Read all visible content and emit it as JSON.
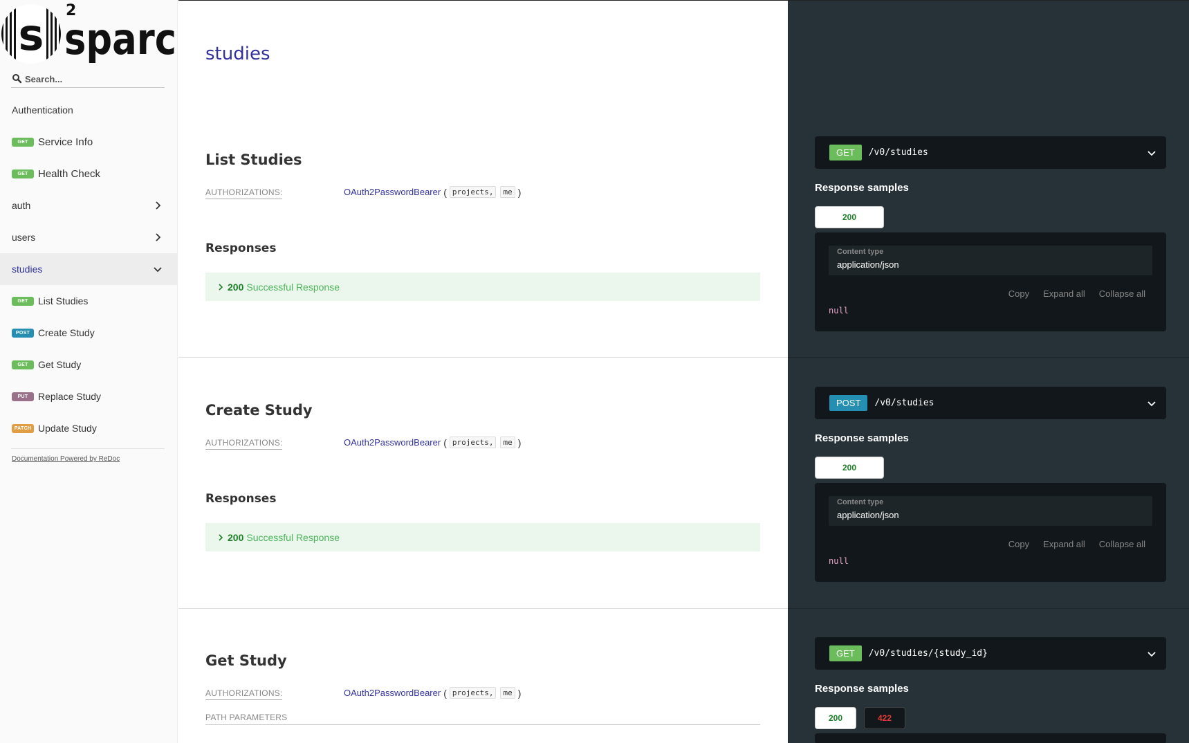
{
  "logo": {
    "text": "sparc",
    "superscript": "2"
  },
  "search": {
    "placeholder": "Search..."
  },
  "sidebar": {
    "items": [
      {
        "label": "Authentication",
        "badge": "",
        "expandable": false,
        "active": false
      },
      {
        "label": "Service Info",
        "badge": "GET",
        "expandable": false,
        "active": false
      },
      {
        "label": "Health Check",
        "badge": "GET",
        "expandable": false,
        "active": false
      },
      {
        "label": "auth",
        "badge": "",
        "expandable": true,
        "expanded": false,
        "active": false
      },
      {
        "label": "users",
        "badge": "",
        "expandable": true,
        "expanded": false,
        "active": false
      },
      {
        "label": "studies",
        "badge": "",
        "expandable": true,
        "expanded": true,
        "active": true
      },
      {
        "label": "List Studies",
        "badge": "GET",
        "expandable": false,
        "active": false
      },
      {
        "label": "Create Study",
        "badge": "POST",
        "expandable": false,
        "active": false
      },
      {
        "label": "Get Study",
        "badge": "GET",
        "expandable": false,
        "active": false
      },
      {
        "label": "Replace Study",
        "badge": "PUT",
        "expandable": false,
        "active": false
      },
      {
        "label": "Update Study",
        "badge": "PATCH",
        "expandable": false,
        "active": false
      }
    ],
    "powered_by": "Documentation Powered by ReDoc"
  },
  "section": {
    "title": "studies"
  },
  "operations": [
    {
      "title": "List Studies",
      "auth_label": "AUTHORIZATIONS:",
      "auth_scheme": "OAuth2PasswordBearer",
      "scopes": [
        "projects,",
        "me"
      ],
      "responses_title": "Responses",
      "response_code": "200",
      "response_text": "Successful Response",
      "method": "GET",
      "path": "/v0/studies",
      "samples_title": "Response samples",
      "tabs": [
        "200"
      ],
      "content_type_label": "Content type",
      "content_type": "application/json",
      "controls": [
        "Copy",
        "Expand all",
        "Collapse all"
      ],
      "sample": "null"
    },
    {
      "title": "Create Study",
      "auth_label": "AUTHORIZATIONS:",
      "auth_scheme": "OAuth2PasswordBearer",
      "scopes": [
        "projects,",
        "me"
      ],
      "responses_title": "Responses",
      "response_code": "200",
      "response_text": "Successful Response",
      "method": "POST",
      "path": "/v0/studies",
      "samples_title": "Response samples",
      "tabs": [
        "200"
      ],
      "content_type_label": "Content type",
      "content_type": "application/json",
      "controls": [
        "Copy",
        "Expand all",
        "Collapse all"
      ],
      "sample": "null"
    },
    {
      "title": "Get Study",
      "auth_label": "AUTHORIZATIONS:",
      "auth_scheme": "OAuth2PasswordBearer",
      "scopes": [
        "projects,",
        "me"
      ],
      "path_params_label": "PATH PARAMETERS",
      "method": "GET",
      "path": "/v0/studies/{study_id}",
      "samples_title": "Response samples",
      "tabs": [
        "200",
        "422"
      ]
    }
  ],
  "colors": {
    "accent": "#32329f",
    "get": "#6bbd5b",
    "post": "#248fb2",
    "put": "#9b708b",
    "patch": "#e09d43",
    "success": "#1d8127",
    "error": "#e53935",
    "right_panel": "#263238"
  }
}
